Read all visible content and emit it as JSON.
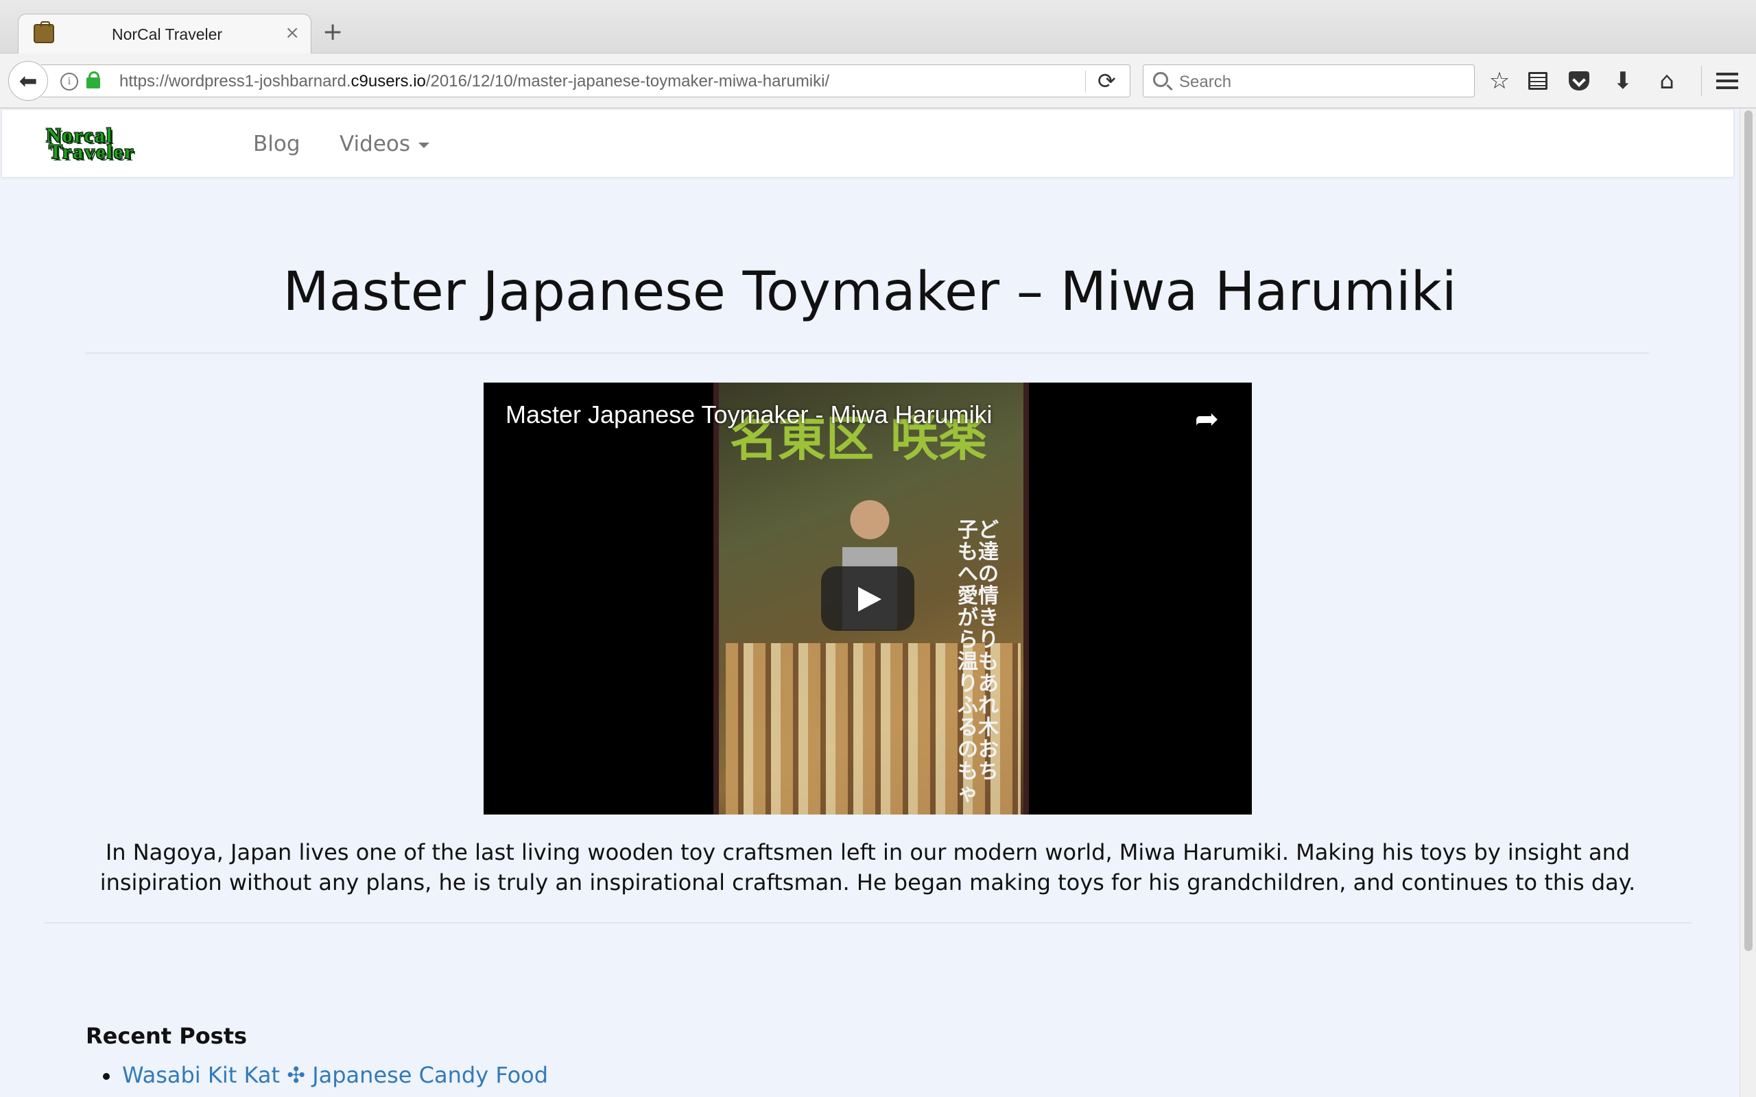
{
  "browser": {
    "tab_title": "NorCal Traveler",
    "tab_close": "×",
    "new_tab": "+",
    "url_prefix": "https://wordpress1-joshbarnard.",
    "url_host": "c9users.io",
    "url_path": "/2016/12/10/master-japanese-toymaker-miwa-harumiki/",
    "search_placeholder": "Search"
  },
  "site": {
    "logo_line1": "Norcal",
    "logo_line2": "Traveler",
    "nav": [
      {
        "label": "Blog"
      },
      {
        "label": "Videos"
      }
    ]
  },
  "post": {
    "title": "Master Japanese Toymaker – Miwa Harumiki",
    "video_title": "Master Japanese Toymaker - Miwa Harumiki",
    "poster_kanji": "名東区 咲楽",
    "poster_vertical_text": "子ども達への愛情がきらり温もりあふれる木のおもちゃ",
    "body": "In Nagoya, Japan lives one of the last living wooden toy craftsmen left in our modern world, Miwa Harumiki. Making his toys by insight and insipiration without any plans, he is truly an inspirational craftsman. He began making toys for his grandchildren, and continues to this day."
  },
  "sidebar": {
    "recent_title": "Recent Posts",
    "recent_posts": [
      {
        "label": "Wasabi Kit Kat ✣ Japanese Candy Food"
      }
    ]
  },
  "colors": {
    "page_bg": "#eef3fc",
    "link": "#337ab7",
    "logo_green": "#1fa01f"
  }
}
